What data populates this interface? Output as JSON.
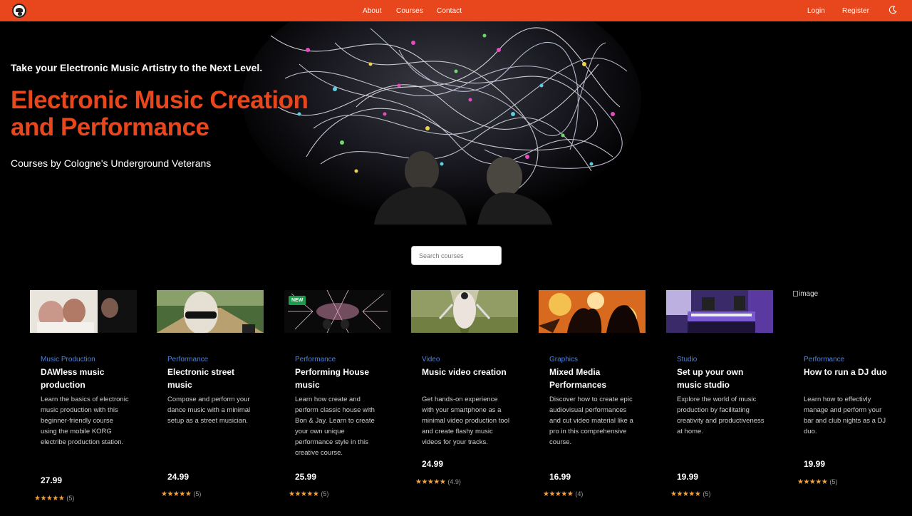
{
  "nav": {
    "about": "About",
    "courses": "Courses",
    "contact": "Contact",
    "login": "Login",
    "register": "Register"
  },
  "hero": {
    "tagline": "Take your Electronic Music Artistry to the Next Level.",
    "headline": "Electronic Music Creation and Performance",
    "sub": "Courses by Cologne's Underground Veterans"
  },
  "search": {
    "placeholder": "Search courses"
  },
  "badge_new": "NEW",
  "broken_image_alt": "image",
  "courses": [
    {
      "category": "Music Production",
      "title": "DAWless music production",
      "desc": "Learn the basics of electronic music production with this beginner-friendly course using the mobile KORG electribe production station.",
      "price": "27.99",
      "rating_count": "(5)",
      "stars": "★★★★★"
    },
    {
      "category": "Performance",
      "title": "Electronic street music",
      "desc": "Compose and perform your dance music with a minimal setup as a street musician.",
      "price": "24.99",
      "rating_count": "(5)",
      "stars": "★★★★★"
    },
    {
      "category": "Performance",
      "title": "Performing House music",
      "desc": "Learn how create and perform classic house with Bon & Jay. Learn to create your own unique performance style in this creative course.",
      "price": "25.99",
      "rating_count": "(5)",
      "stars": "★★★★★"
    },
    {
      "category": "Video",
      "title": "Music video creation",
      "desc": "Get hands-on experience with your smartphone as a minimal video production tool and create flashy music videos for your tracks.",
      "price": "24.99",
      "rating_count": "(4.9)",
      "stars": "★★★★★"
    },
    {
      "category": "Graphics",
      "title": "Mixed Media Performances",
      "desc": "Discover how to create epic audiovisual performances and cut video material like a pro in this comprehensive course.",
      "price": "16.99",
      "rating_count": "(4)",
      "stars": "★★★★★"
    },
    {
      "category": "Studio",
      "title": "Set up your own music studio",
      "desc": "Explore the world of music production by facilitating creativity and productiveness at home.",
      "price": "19.99",
      "rating_count": "(5)",
      "stars": "★★★★★"
    },
    {
      "category": "Performance",
      "title": "How to run a DJ duo",
      "desc": "Learn how to effectivly manage and perform your bar and club nights as a DJ duo.",
      "price": "19.99",
      "rating_count": "(5)",
      "stars": "★★★★★"
    }
  ]
}
